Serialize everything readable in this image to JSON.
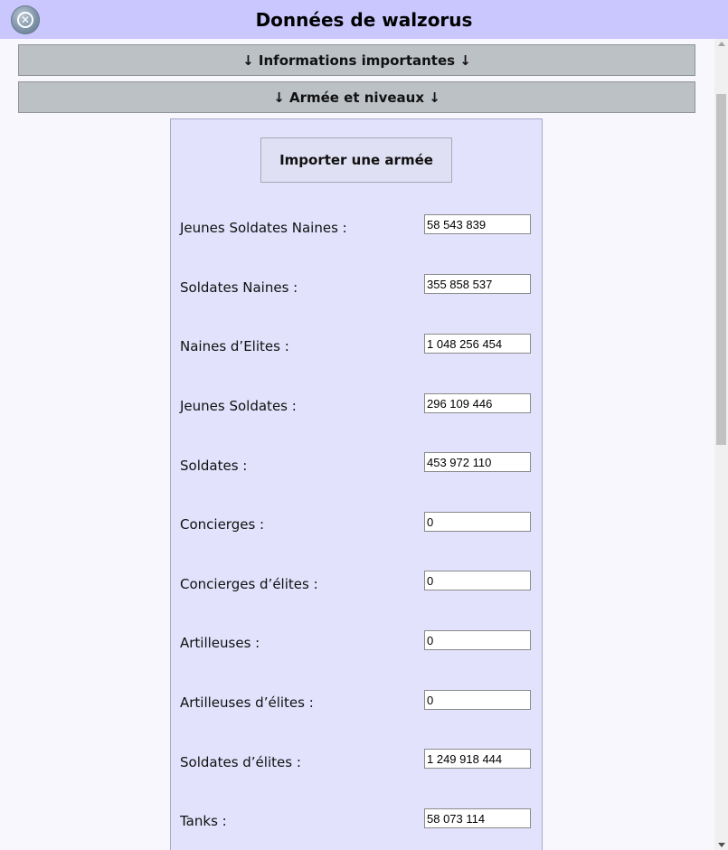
{
  "dialog": {
    "title": "Données de walzorus",
    "close_icon": "close-circle-icon"
  },
  "sections": [
    {
      "label": "↓ Informations importantes ↓"
    },
    {
      "label": "↓ Armée et niveaux ↓"
    }
  ],
  "army": {
    "import_label": "Importer une armée",
    "rows": [
      {
        "label": "Jeunes Soldates Naines :",
        "value": "58 543 839"
      },
      {
        "label": "Soldates Naines :",
        "value": "355 858 537"
      },
      {
        "label": "Naines d’Elites :",
        "value": "1 048 256 454"
      },
      {
        "label": "Jeunes Soldates :",
        "value": "296 109 446"
      },
      {
        "label": "Soldates :",
        "value": "453 972 110"
      },
      {
        "label": "Concierges :",
        "value": "0"
      },
      {
        "label": "Concierges d’élites :",
        "value": "0"
      },
      {
        "label": "Artilleuses :",
        "value": "0"
      },
      {
        "label": "Artilleuses d’élites :",
        "value": "0"
      },
      {
        "label": "Soldates d’élites :",
        "value": "1 249 918 444"
      },
      {
        "label": "Tanks :",
        "value": "58 073 114"
      }
    ]
  }
}
